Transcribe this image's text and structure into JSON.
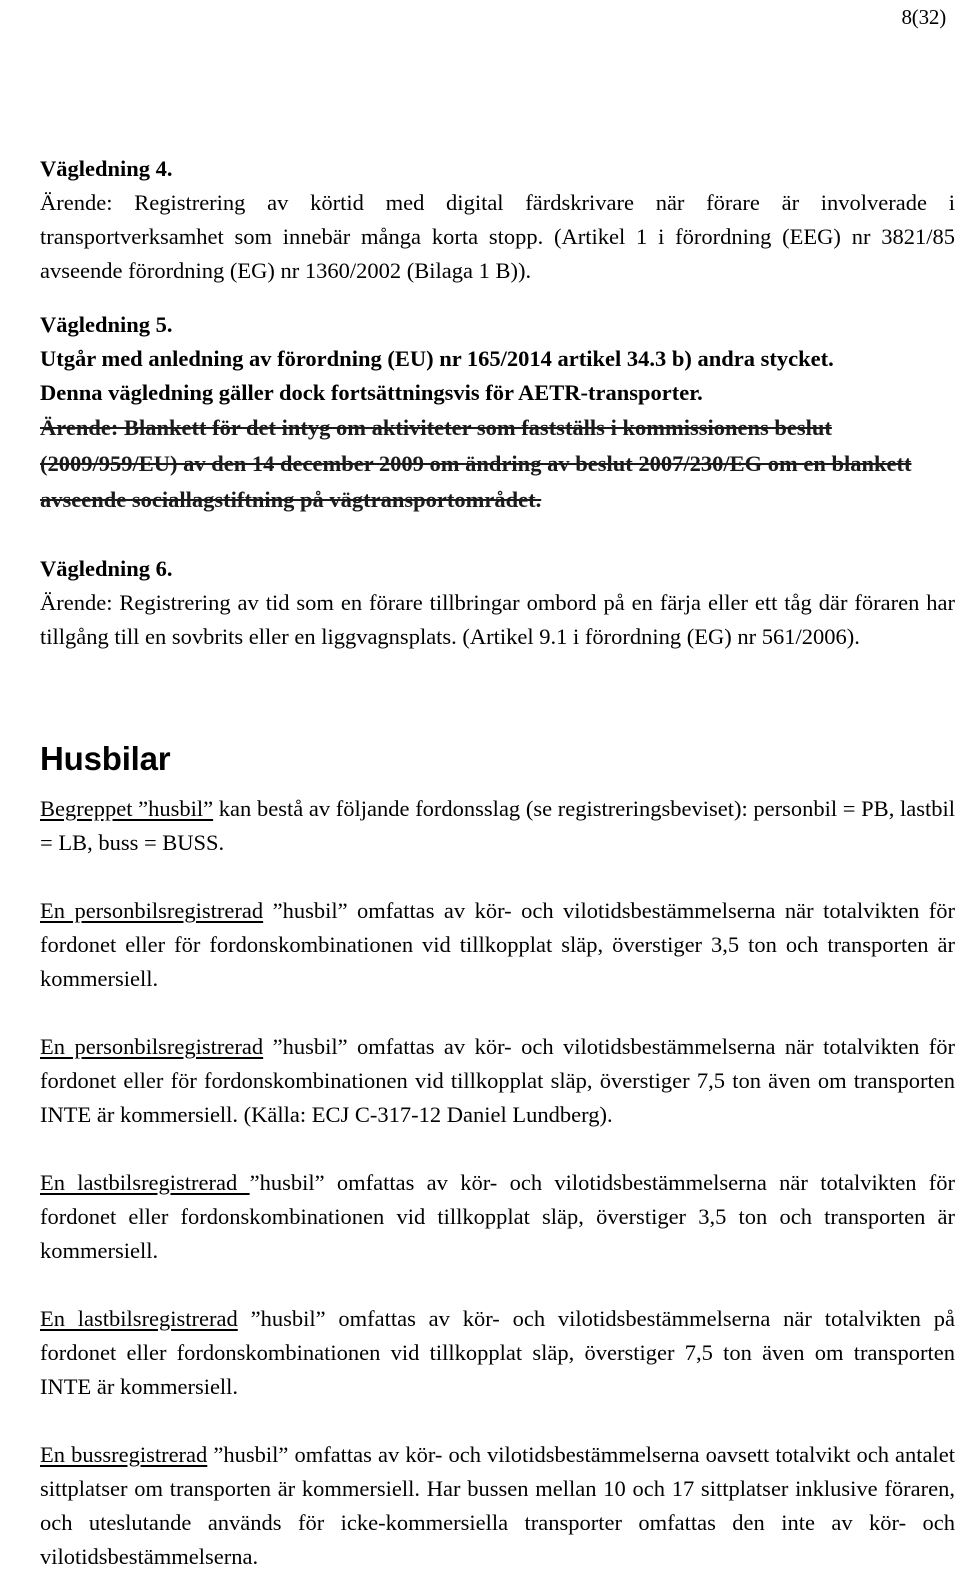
{
  "page": {
    "number_label": "8(32)",
    "language": "sv"
  },
  "sections": {
    "vagledning4": {
      "heading": "Vägledning 4.",
      "body": "Ärende: Registrering av körtid med digital färdskrivare när förare är involverade i transportverksamhet som innebär många korta stopp. (Artikel 1 i förordning (EEG) nr 3821/85 avseende förordning (EG) nr 1360/2002 (Bilaga 1 B))."
    },
    "vagledning5": {
      "heading": "Vägledning 5.",
      "bold_line_1": "Utgår med anledning av förordning (EU) nr 165/2014 artikel 34.3 b) andra stycket.",
      "bold_line_2": "Denna vägledning gäller dock fortsättningsvis för AETR-transporter.",
      "struck_text": "Ärende: Blankett för det intyg om aktiviteter som fastställs i kommissionens beslut (2009/959/EU) av den 14 december 2009 om ändring av beslut 2007/230/EG om en blankett avseende sociallagstiftning på vägtransportområdet."
    },
    "vagledning6": {
      "heading": "Vägledning 6.",
      "body": "Ärende: Registrering av tid som en förare tillbringar ombord på en färja eller ett tåg där föraren har tillgång till en sovbrits eller en liggvagnsplats. (Artikel 9.1 i förordning (EG) nr 561/2006)."
    },
    "husbilar": {
      "title": "Husbilar",
      "intro": {
        "underlined_lead": "Begreppet ”husbil”",
        "rest": " kan bestå av följande fordonsslag (se registreringsbeviset): personbil = PB, lastbil = LB, buss = BUSS."
      },
      "paragraphs": [
        {
          "underlined_lead": "En personbilsregistrerad",
          "rest": " ”husbil” omfattas av kör- och vilotidsbestämmelserna när totalvikten för fordonet eller för fordonskombinationen vid tillkopplat släp, överstiger 3,5 ton och transporten är kommersiell."
        },
        {
          "underlined_lead": "En personbilsregistrerad",
          "rest": " ”husbil” omfattas av kör- och vilotidsbestämmelserna när totalvikten för fordonet eller för fordonskombinationen vid tillkopplat släp, överstiger 7,5 ton även om transporten INTE är kommersiell. (Källa: ECJ C-317-12 Daniel Lundberg)."
        },
        {
          "underlined_lead": "En lastbilsregistrerad ",
          "rest": "”husbil” omfattas av kör- och vilotidsbestämmelserna när totalvikten för fordonet eller fordonskombinationen vid tillkopplat släp, överstiger 3,5 ton och transporten är kommersiell."
        },
        {
          "underlined_lead": "En lastbilsregistrerad",
          "rest": " ”husbil” omfattas av kör- och vilotidsbestämmelserna när totalvikten på fordonet eller fordonskombinationen vid tillkopplat släp, överstiger 7,5 ton även om transporten INTE är kommersiell."
        },
        {
          "underlined_lead": "En bussregistrerad",
          "rest": " ”husbil” omfattas av kör- och vilotidsbestämmelserna oavsett totalvikt och antalet sittplatser om transporten är kommersiell. Har bussen mellan 10 och 17 sittplatser inklusive föraren, och uteslutande används för icke-kommersiella transporter omfattas den inte av kör- och vilotidsbestämmelserna."
        }
      ]
    }
  }
}
